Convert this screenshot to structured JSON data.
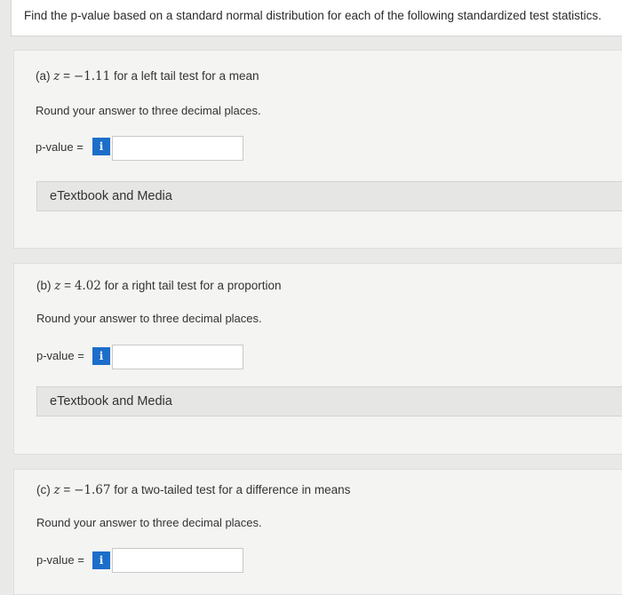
{
  "header": {
    "instruction": "Find the p-value based on a standard normal distribution for each of the following standardized test statistics."
  },
  "questions": [
    {
      "label_prefix": "(a)",
      "z_symbol": "z",
      "equals": "=",
      "z_value": "−1.11",
      "label_suffix": "for a left tail test for a mean",
      "round_text": "Round your answer to three decimal places.",
      "pvalue_label": "p-value =",
      "info_icon": "i",
      "input_value": "",
      "etext_label": "eTextbook and Media"
    },
    {
      "label_prefix": "(b)",
      "z_symbol": "z",
      "equals": "=",
      "z_value": "4.02",
      "label_suffix": "for a right tail test for a proportion",
      "round_text": "Round your answer to three decimal places.",
      "pvalue_label": "p-value =",
      "info_icon": "i",
      "input_value": "",
      "etext_label": "eTextbook and Media"
    },
    {
      "label_prefix": "(c)",
      "z_symbol": "z",
      "equals": "=",
      "z_value": "−1.67",
      "label_suffix": "for a two-tailed test for a difference in means",
      "round_text": "Round your answer to three decimal places.",
      "pvalue_label": "p-value =",
      "info_icon": "i",
      "input_value": ""
    }
  ]
}
